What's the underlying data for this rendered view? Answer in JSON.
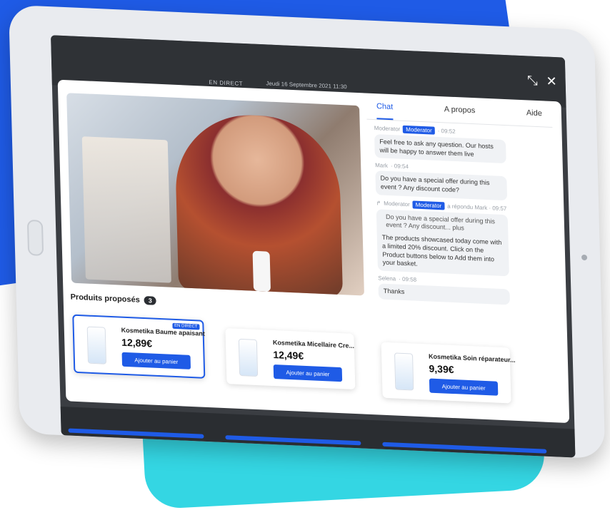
{
  "colors": {
    "accent": "#1f5be6",
    "background_blue": "#1f5be6",
    "background_cyan": "#34d6e3"
  },
  "topbar": {
    "live_label": "EN DIRECT",
    "date_text": "Jeudi 16 Septembre 2021 11:30",
    "icons": [
      "expand-icon",
      "close-icon"
    ]
  },
  "video": {
    "alt": "live-stream-video"
  },
  "produits": {
    "label": "Produits proposés",
    "count": "3"
  },
  "chat": {
    "tabs": [
      "Chat",
      "A propos",
      "Aide"
    ],
    "messages": [
      {
        "author": "Moderator",
        "badge": "Moderator",
        "time": "· 09:52",
        "text": "Feel free to ask any question. Our hosts will be happy to answer them live"
      },
      {
        "author": "Mark",
        "badge": "",
        "time": "· 09:54",
        "text": "Do you have a special offer during this event ? Any discount code?"
      },
      {
        "author": "Moderator",
        "badge": "Moderator",
        "time": "a répondu Mark · 09:57",
        "quote": "Do you have a special offer during this event ? Any discount... plus",
        "text": "The products showcased today come with a limited 20% discount. Click on the Product buttons below to Add them into your basket."
      },
      {
        "author": "Selena",
        "badge": "",
        "time": "· 09:58",
        "text": "Thanks"
      }
    ]
  },
  "products": [
    {
      "name": "Kosmetika Baume apaisant",
      "price": "12,89€",
      "button": "Ajouter au panier",
      "tag": "EN DIRECT"
    },
    {
      "name": "Kosmetika Micellaire Cre...",
      "price": "12,49€",
      "button": "Ajouter au panier"
    },
    {
      "name": "Kosmetika Soin réparateur...",
      "price": "9,39€",
      "button": "Ajouter au panier"
    }
  ]
}
